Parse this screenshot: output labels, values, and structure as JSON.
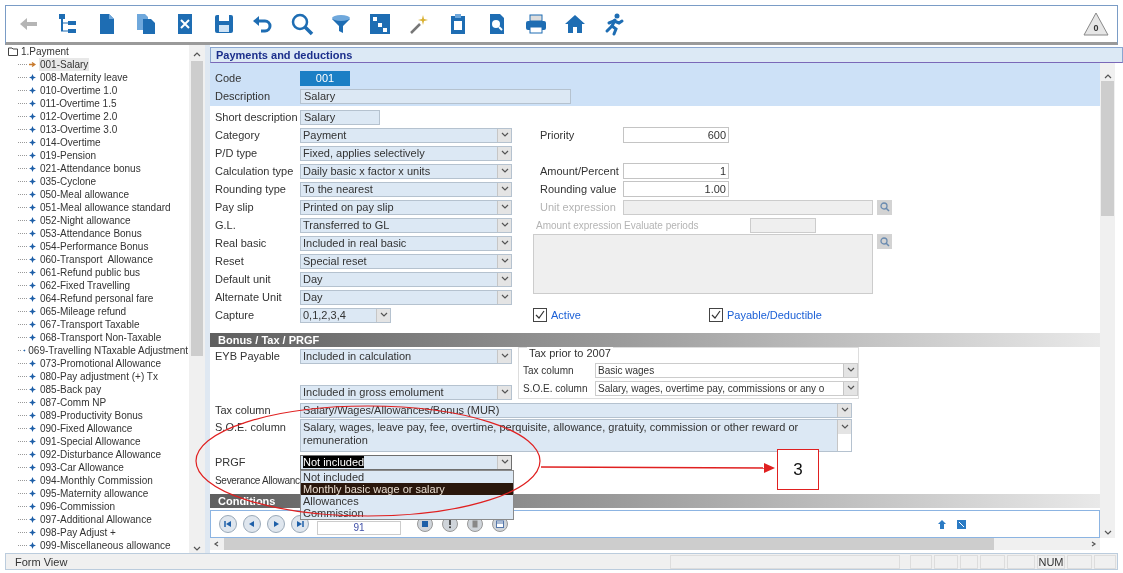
{
  "toolbar": {
    "buttons": [
      {
        "kind": "back",
        "disabled": true
      },
      {
        "kind": "tree",
        "disabled": false
      },
      {
        "kind": "new",
        "disabled": false
      },
      {
        "kind": "copy",
        "disabled": false
      },
      {
        "kind": "delete",
        "disabled": false
      },
      {
        "kind": "save",
        "disabled": false
      },
      {
        "kind": "undo",
        "disabled": false
      },
      {
        "kind": "search",
        "disabled": false
      },
      {
        "kind": "filter",
        "disabled": false
      },
      {
        "kind": "format",
        "disabled": false
      },
      {
        "kind": "wand",
        "disabled": false
      },
      {
        "kind": "clipboard",
        "disabled": false
      },
      {
        "kind": "preview",
        "disabled": false
      },
      {
        "kind": "print",
        "disabled": false
      },
      {
        "kind": "home",
        "disabled": false
      },
      {
        "kind": "run",
        "disabled": false
      }
    ],
    "alert": {
      "count": "0"
    }
  },
  "tree": {
    "root": {
      "label": "1.Payment",
      "expanded": true,
      "children": [
        {
          "label": "001-Salary",
          "selected": true
        },
        {
          "label": "008-Maternity leave",
          "selected": false
        },
        {
          "label": "010-Overtime 1.0",
          "selected": false
        },
        {
          "label": "011-Overtime 1.5",
          "selected": false
        },
        {
          "label": "012-Overtime 2.0",
          "selected": false
        },
        {
          "label": "013-Overtime 3.0",
          "selected": false
        },
        {
          "label": "014-Overtime",
          "selected": false
        },
        {
          "label": "019-Pension",
          "selected": false
        },
        {
          "label": "021-Attendance bonus",
          "selected": false
        },
        {
          "label": "035-Cyclone",
          "selected": false
        },
        {
          "label": "050-Meal allowance",
          "selected": false
        },
        {
          "label": "051-Meal allowance standard",
          "selected": false
        },
        {
          "label": "052-Night allowance",
          "selected": false
        },
        {
          "label": "053-Attendance Bonus",
          "selected": false
        },
        {
          "label": "054-Performance Bonus",
          "selected": false
        },
        {
          "label": "060-Transport  Allowance",
          "selected": false
        },
        {
          "label": "061-Refund public bus",
          "selected": false
        },
        {
          "label": "062-Fixed Travelling",
          "selected": false
        },
        {
          "label": "064-Refund personal fare",
          "selected": false
        },
        {
          "label": "065-Mileage refund",
          "selected": false
        },
        {
          "label": "067-Transport Taxable",
          "selected": false
        },
        {
          "label": "068-Transport Non-Taxable",
          "selected": false
        },
        {
          "label": "069-Travelling NTaxable Adjustment",
          "selected": false
        },
        {
          "label": "073-Promotional Allowance",
          "selected": false
        },
        {
          "label": "080-Pay adjustment (+) Tx",
          "selected": false
        },
        {
          "label": "085-Back pay",
          "selected": false
        },
        {
          "label": "087-Comm NP",
          "selected": false
        },
        {
          "label": "089-Productivity Bonus",
          "selected": false
        },
        {
          "label": "090-Fixed Allowance",
          "selected": false
        },
        {
          "label": "091-Special Allowance",
          "selected": false
        },
        {
          "label": "092-Disturbance Allowance",
          "selected": false
        },
        {
          "label": "093-Car Allowance",
          "selected": false
        },
        {
          "label": "094-Monthly Commission",
          "selected": false
        },
        {
          "label": "095-Maternity allowance",
          "selected": false
        },
        {
          "label": "096-Commission",
          "selected": false
        },
        {
          "label": "097-Additional Allowance",
          "selected": false
        },
        {
          "label": "098-Pay Adjust +",
          "selected": false
        },
        {
          "label": "099-Miscellaneous allowance",
          "selected": false
        }
      ]
    }
  },
  "form": {
    "title": "Payments and deductions",
    "code": {
      "label": "Code",
      "value": "001"
    },
    "description": {
      "label": "Description",
      "value": "Salary"
    },
    "left_fields": [
      {
        "kind": "text",
        "label": "Short description",
        "value": "Salary"
      },
      {
        "kind": "select",
        "label": "Category",
        "value": "Payment"
      },
      {
        "kind": "select",
        "label": "P/D type",
        "value": "Fixed, applies selectively"
      },
      {
        "kind": "select",
        "label": "Calculation type",
        "value": "Daily basic x factor x units"
      },
      {
        "kind": "select",
        "label": "Rounding type",
        "value": "To the nearest"
      },
      {
        "kind": "select",
        "label": "Pay slip",
        "value": "Printed on pay slip"
      },
      {
        "kind": "select",
        "label": "G.L.",
        "value": "Transferred to GL"
      },
      {
        "kind": "select",
        "label": "Real basic",
        "value": "Included in real basic"
      },
      {
        "kind": "select",
        "label": "Reset",
        "value": "Special reset"
      },
      {
        "kind": "select",
        "label": "Default unit",
        "value": "Day"
      },
      {
        "kind": "select",
        "label": "Alternate Unit",
        "value": "Day"
      },
      {
        "kind": "small_select",
        "label": "Capture",
        "value": "0,1,2,3,4"
      }
    ],
    "priority": {
      "label": "Priority",
      "value": "600"
    },
    "amounts": [
      {
        "label": "Amount/Percent",
        "value": "1"
      },
      {
        "label": "Rounding value",
        "value": "1.00"
      }
    ],
    "unit_expression": {
      "label": "Unit expression",
      "disabled": true
    },
    "amount_expression": {
      "label": "Amount expression",
      "periods_label": "Evaluate periods",
      "disabled": true
    },
    "checks": [
      {
        "label": "Active",
        "checked": true
      },
      {
        "label": "Payable/Deductible",
        "checked": true
      }
    ]
  },
  "bonus": {
    "title": "Bonus / Tax / PRGF",
    "eyb": {
      "label": "EYB Payable",
      "value": "Included in calculation"
    },
    "gross": {
      "value": "Included in gross emolument"
    },
    "tax_prior": {
      "title": "Tax prior to 2007",
      "fields": [
        {
          "label": "Tax column",
          "value": "Basic wages"
        },
        {
          "label": "S.O.E. column",
          "value": "Salary, wages, overtime pay, commissions or any o"
        }
      ]
    },
    "tax_column": {
      "label": "Tax column",
      "value": "Salary/Wages/Allowances/Bonus (MUR)"
    },
    "soe_column": {
      "label": "S.O.E. column",
      "value": "Salary, wages, leave pay, fee, overtime, perquisite, allowance, gratuity, commission or other reward or remuneration"
    },
    "prgf": {
      "label": "PRGF",
      "value": "Not included",
      "open": true,
      "options": [
        {
          "label": "Not included",
          "highlighted": false
        },
        {
          "label": "Monthly basic wage or salary",
          "highlighted": true
        },
        {
          "label": "Allowances",
          "highlighted": false
        },
        {
          "label": "Commission",
          "highlighted": false
        }
      ]
    },
    "severance": {
      "label": "Severance Allowanc"
    }
  },
  "conditions": {
    "title": "Conditions",
    "record": "91"
  },
  "status_bar": {
    "mode": "Form View",
    "indicator": "NUM"
  },
  "annotation": {
    "label": "3"
  }
}
